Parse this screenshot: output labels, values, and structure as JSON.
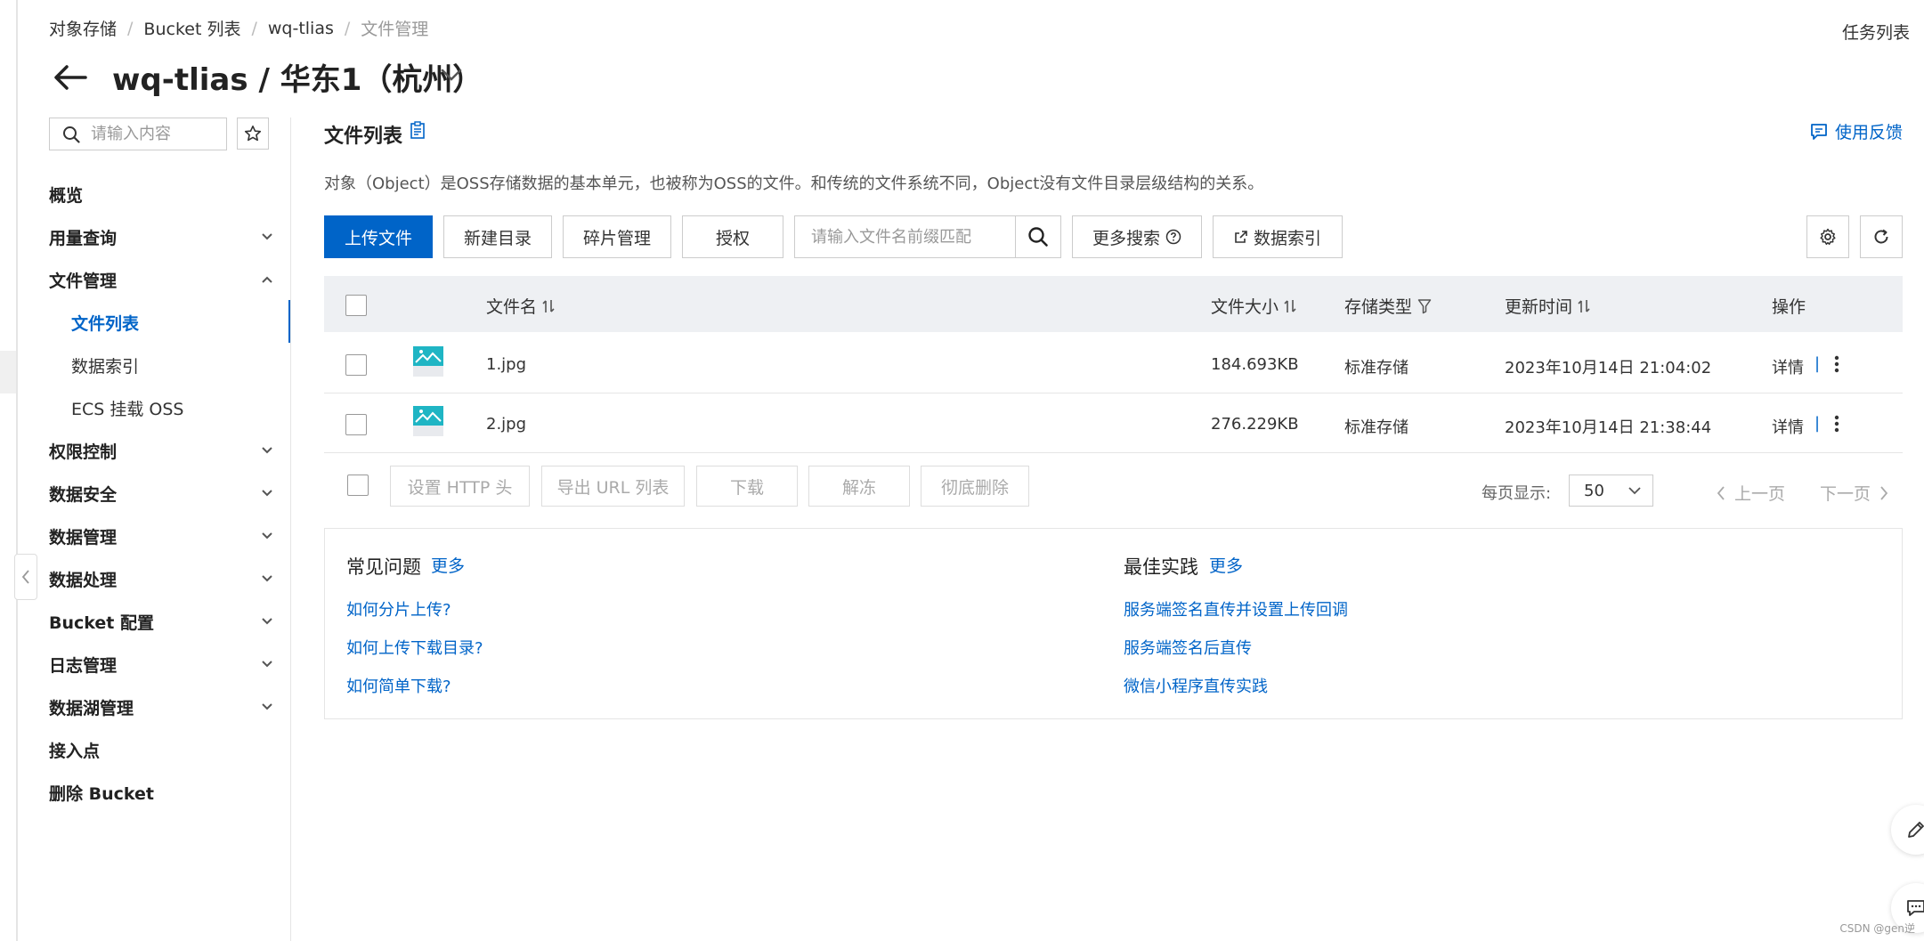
{
  "breadcrumb": {
    "items": [
      "对象存储",
      "Bucket 列表",
      "wq-tlias"
    ],
    "current": "文件管理"
  },
  "task_list": "任务列表",
  "title": "wq-tlias / 华东1（杭州）",
  "sidebar": {
    "search_placeholder": "请输入内容",
    "items": [
      {
        "label": "概览"
      },
      {
        "label": "用量查询"
      },
      {
        "label": "文件管理"
      },
      {
        "label": "文件列表"
      },
      {
        "label": "数据索引"
      },
      {
        "label": "ECS 挂载 OSS"
      },
      {
        "label": "权限控制"
      },
      {
        "label": "数据安全"
      },
      {
        "label": "数据管理"
      },
      {
        "label": "数据处理"
      },
      {
        "label": "Bucket 配置"
      },
      {
        "label": "日志管理"
      },
      {
        "label": "数据湖管理"
      },
      {
        "label": "接入点"
      },
      {
        "label": "删除 Bucket"
      }
    ]
  },
  "main": {
    "section_title": "文件列表",
    "feedback": "使用反馈",
    "description": "对象（Object）是OSS存储数据的基本单元，也被称为OSS的文件。和传统的文件系统不同，Object没有文件目录层级结构的关系。",
    "toolbar": {
      "upload": "上传文件",
      "new_dir": "新建目录",
      "fragments": "碎片管理",
      "authorize": "授权",
      "search_placeholder": "请输入文件名前缀匹配",
      "more_search": "更多搜索",
      "data_index": "数据索引"
    },
    "table": {
      "columns": {
        "name": "文件名",
        "size": "文件大小",
        "storage": "存储类型",
        "updated": "更新时间",
        "actions": "操作"
      },
      "rows": [
        {
          "name": "1.jpg",
          "size": "184.693KB",
          "storage": "标准存储",
          "updated": "2023年10月14日 21:04:02",
          "action": "详情",
          "sep": "|"
        },
        {
          "name": "2.jpg",
          "size": "276.229KB",
          "storage": "标准存储",
          "updated": "2023年10月14日 21:38:44",
          "action": "详情",
          "sep": "|"
        }
      ]
    },
    "batch": {
      "set_http_header": "设置 HTTP 头",
      "export_urls": "导出 URL 列表",
      "download": "下载",
      "unfreeze": "解冻",
      "delete": "彻底删除"
    },
    "pagination": {
      "page_size_label": "每页显示:",
      "page_size": "50",
      "prev": "上一页",
      "next": "下一页"
    },
    "help": {
      "faq_title": "常见问题",
      "faq_more": "更多",
      "faq_links": [
        "如何分片上传?",
        "如何上传下载目录?",
        "如何简单下载?"
      ],
      "best_title": "最佳实践",
      "best_more": "更多",
      "best_links": [
        "服务端签名直传并设置上传回调",
        "服务端签名后直传",
        "微信小程序直传实践"
      ]
    }
  },
  "watermark": "CSDN @gen逆",
  "colors": {
    "accent": "#0064c8",
    "header_bg": "#eef0f3",
    "file_icon": "#1fb5c4"
  }
}
